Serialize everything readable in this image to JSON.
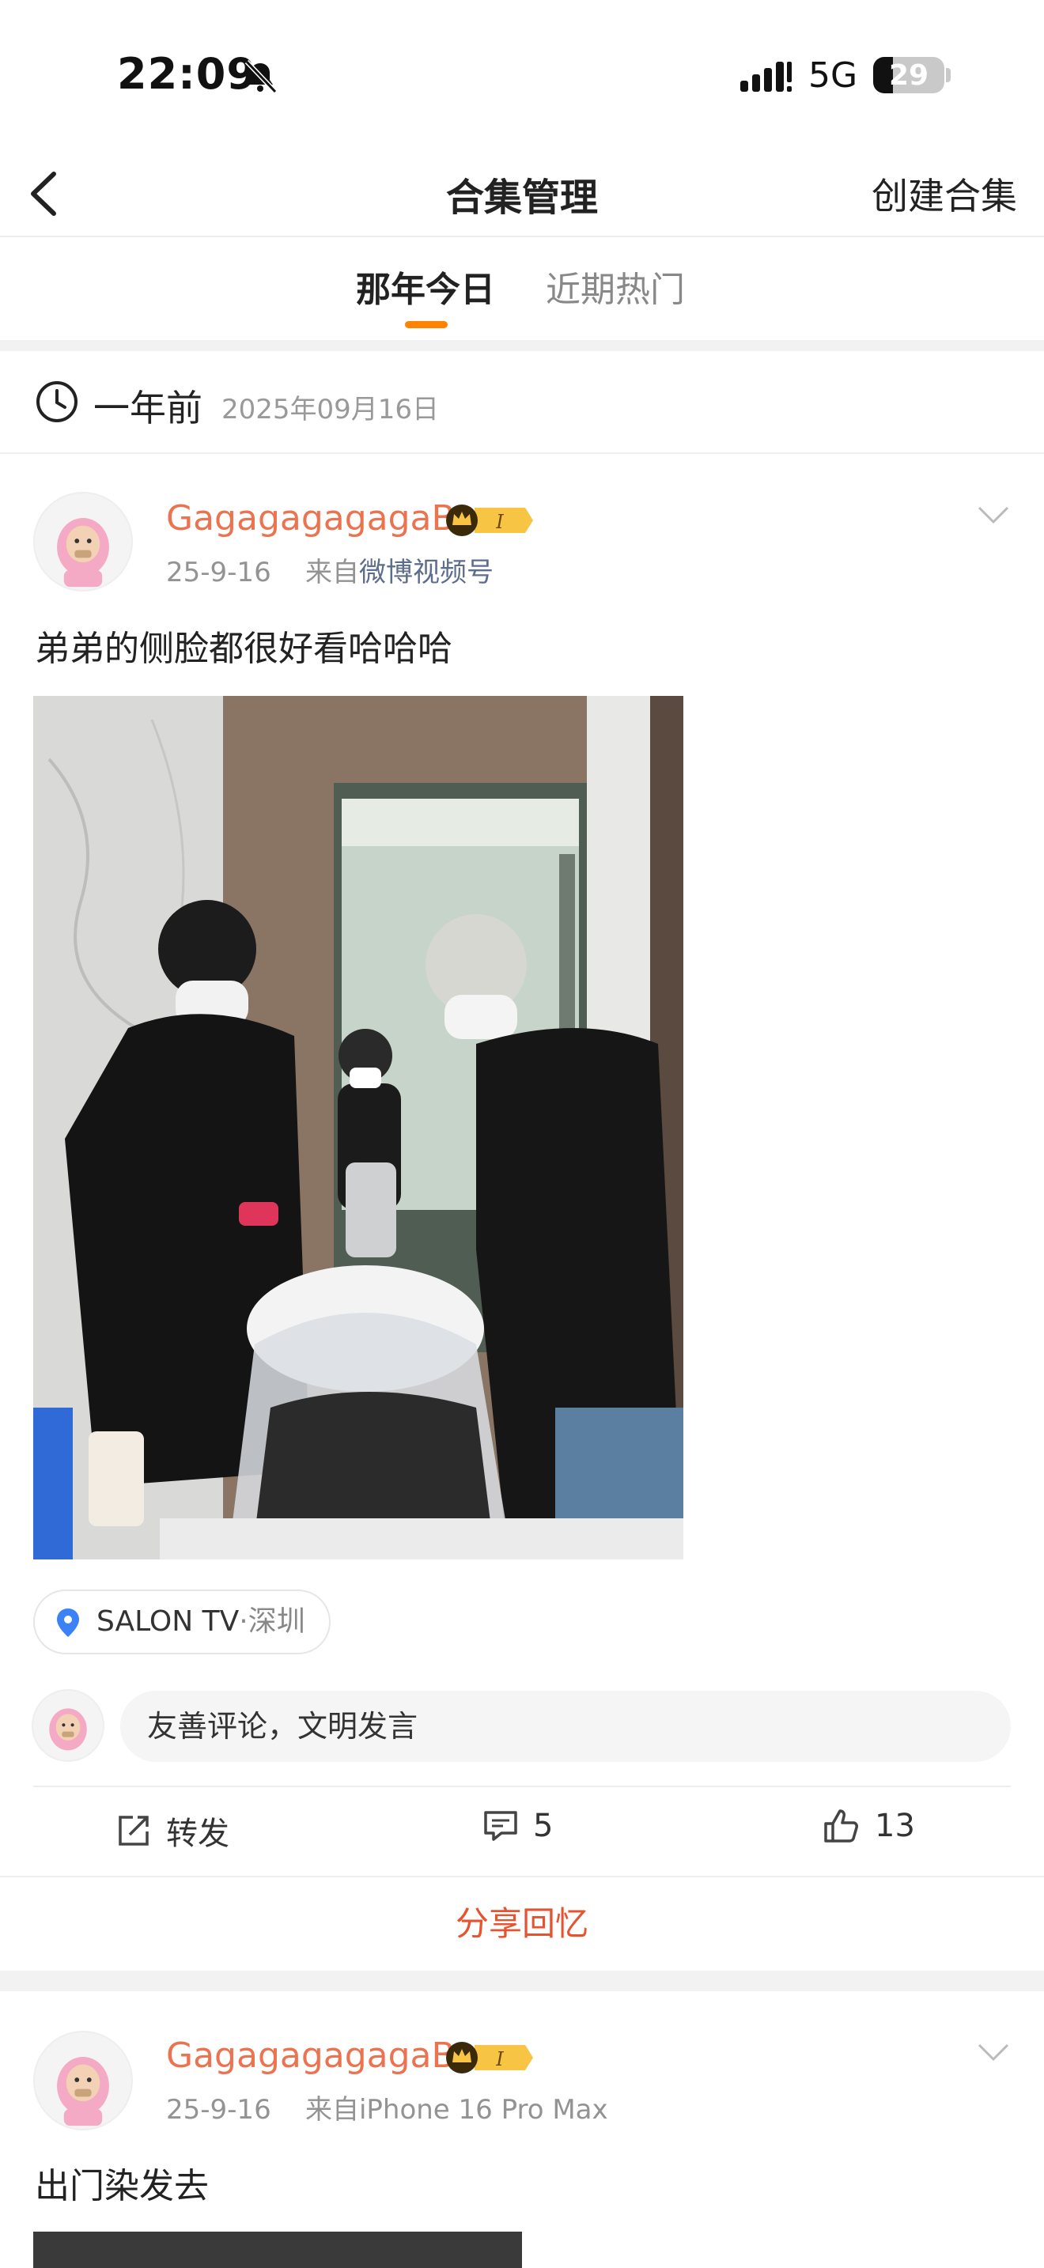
{
  "status_bar": {
    "time": "22:09",
    "network": "5G",
    "battery": "29"
  },
  "nav": {
    "title": "合集管理",
    "action": "创建合集"
  },
  "tabs": [
    {
      "label": "那年今日",
      "active": true
    },
    {
      "label": "近期热门",
      "active": false
    }
  ],
  "date_header": {
    "ago": "一年前",
    "date": "2025年09月16日"
  },
  "posts": [
    {
      "username": "GagagagagagaB",
      "date": "25-9-16",
      "source_prefix": "来自",
      "source": "微博视频号",
      "text": "弟弟的侧脸都很好看哈哈哈",
      "location": "SALON TV",
      "city": "·深圳",
      "comment_placeholder": "友善评论，文明发言",
      "repost_label": "转发",
      "comment_count": "5",
      "like_count": "13",
      "share_memory": "分享回忆"
    },
    {
      "username": "GagagagagagaB",
      "date": "25-9-16",
      "source_prefix": "来自",
      "source": "iPhone 16 Pro Max",
      "text": "出门染发去"
    }
  ],
  "colors": {
    "accent": "#ff8200",
    "username": "#eb7350",
    "share": "#e6532e"
  }
}
